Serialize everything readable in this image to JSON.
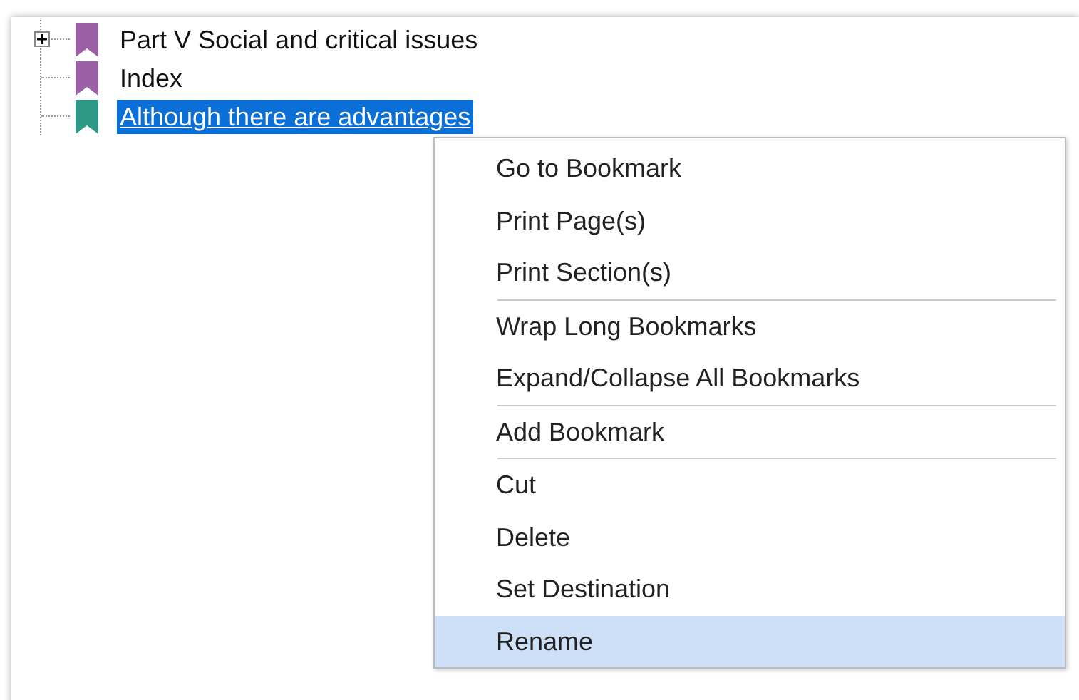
{
  "bookmarks": [
    {
      "label": "Part V Social and critical issues",
      "color": "#9b5fa6",
      "selected": false,
      "expanded": false
    },
    {
      "label": "Index",
      "color": "#9b5fa6",
      "selected": false
    },
    {
      "label": "Although there are advantages",
      "color": "#2e9a86",
      "selected": true
    }
  ],
  "context_menu": [
    {
      "kind": "item",
      "label": "Go to Bookmark",
      "selected": false
    },
    {
      "kind": "item",
      "label": "Print Page(s)",
      "selected": false
    },
    {
      "kind": "item",
      "label": "Print Section(s)",
      "selected": false
    },
    {
      "kind": "separator"
    },
    {
      "kind": "item",
      "label": "Wrap Long Bookmarks",
      "selected": false
    },
    {
      "kind": "item",
      "label": "Expand/Collapse All Bookmarks",
      "selected": false
    },
    {
      "kind": "separator"
    },
    {
      "kind": "item",
      "label": "Add Bookmark",
      "selected": false
    },
    {
      "kind": "separator"
    },
    {
      "kind": "item",
      "label": "Cut",
      "selected": false
    },
    {
      "kind": "item",
      "label": "Delete",
      "selected": false
    },
    {
      "kind": "item",
      "label": "Set Destination",
      "selected": false
    },
    {
      "kind": "item",
      "label": "Rename",
      "selected": true
    }
  ]
}
